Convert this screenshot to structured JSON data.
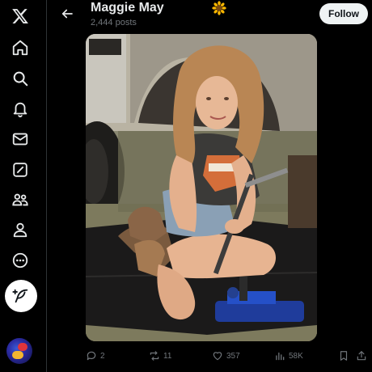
{
  "colors": {
    "background": "#000000",
    "text_primary": "#e7e9ea",
    "text_secondary": "#71767b",
    "follow_bg": "#eff3f4",
    "follow_text": "#0f1419",
    "divider": "#2f3336"
  },
  "nav": {
    "items": [
      {
        "icon": "x-logo-icon"
      },
      {
        "icon": "home-icon"
      },
      {
        "icon": "search-icon"
      },
      {
        "icon": "notifications-bell-icon"
      },
      {
        "icon": "messages-envelope-icon"
      },
      {
        "icon": "grok-icon"
      },
      {
        "icon": "communities-icon"
      },
      {
        "icon": "profile-icon"
      },
      {
        "icon": "more-circle-icon"
      }
    ],
    "post_button_icon": "feather-plus-icon",
    "account_avatar": "account-avatar"
  },
  "header": {
    "back_icon": "back-arrow-icon",
    "name": "Maggie May",
    "name_emoji": "sunflower-icon",
    "posts_count": "2,444 posts",
    "follow_label": "Follow"
  },
  "media": {
    "description_icon": "photo"
  },
  "actions": {
    "replies": "2",
    "reposts": "11",
    "likes": "357",
    "views": "58K"
  }
}
